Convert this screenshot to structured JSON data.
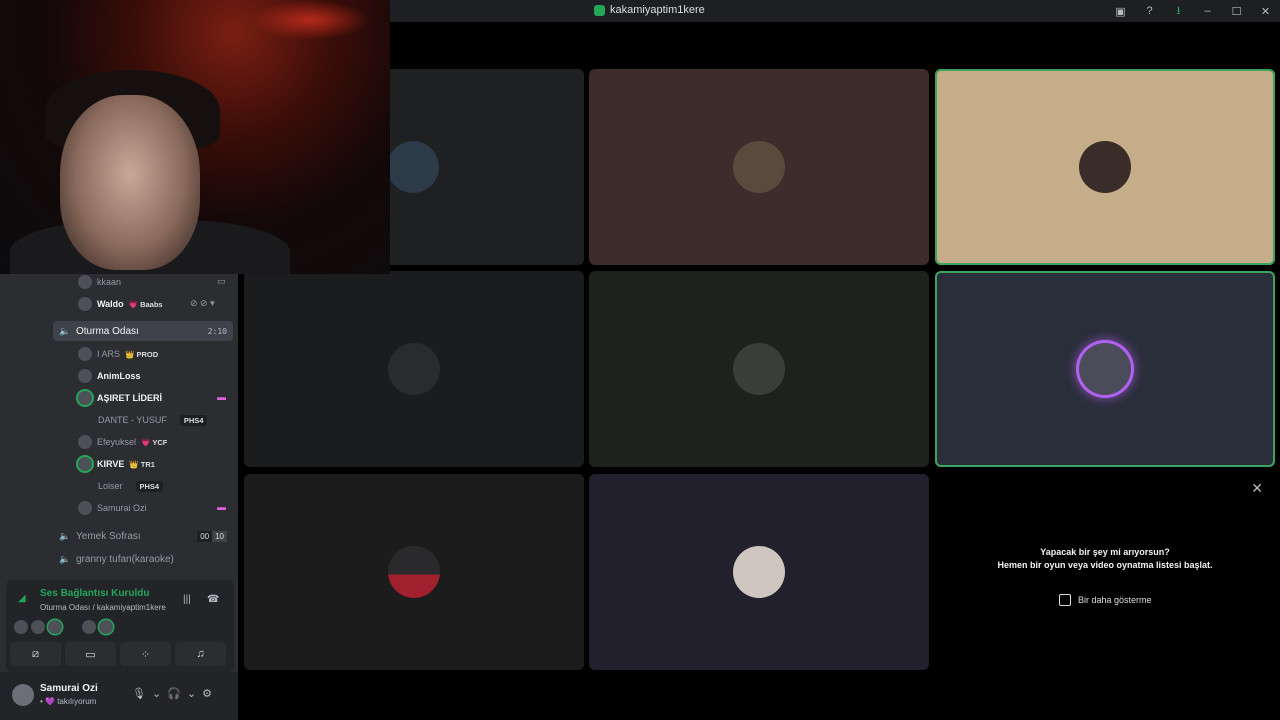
{
  "titlebar": {
    "title": "kakamiyaptim1kere",
    "icons": [
      "inbox-icon",
      "help-icon",
      "download-icon",
      "minimize-icon",
      "maximize-icon",
      "close-icon"
    ]
  },
  "sidebar": {
    "upper_members": [
      {
        "name": "kkaan",
        "tag": ""
      },
      {
        "name": "Waldo",
        "tag": "💗 Baabs"
      }
    ],
    "channels": [
      {
        "name": "Oturma Odası",
        "timer": "2:10",
        "active": true,
        "members": [
          {
            "name": "I ARS",
            "tag": "👑 PROD"
          },
          {
            "name": "AnimLoss",
            "tag": ""
          },
          {
            "name": "AŞIRET LİDERİ",
            "tag": ""
          },
          {
            "name": "DANTE - YUSUF",
            "tag": "PHS4"
          },
          {
            "name": "Efeyuksel",
            "tag": "💗 YCF"
          },
          {
            "name": "KIRVE",
            "tag": "👑 TR1"
          },
          {
            "name": "Loiser",
            "tag": "PHS4"
          },
          {
            "name": "Samurai Ozi",
            "tag": ""
          }
        ]
      },
      {
        "name": "Yemek Sofrası",
        "count_a": "00",
        "count_b": "10"
      },
      {
        "name": "granny tufan(karaoke)"
      }
    ]
  },
  "voice_panel": {
    "status": "Ses Bağlantısı Kuruldu",
    "location": "Oturma Odası / kakamiyaptim1kere",
    "buttons": [
      "camera-off-icon",
      "screen-share-icon",
      "activities-icon",
      "soundboard-icon"
    ]
  },
  "user": {
    "name": "Samurai Ozi",
    "status": "• 💜 takılıyorum"
  },
  "activity_prompt": {
    "line1": "Yapacak bir şey mi arıyorsun?",
    "line2": "Hemen bir oyun veya video oynatma listesi başlat.",
    "checkbox": "Bir daha gösterme"
  },
  "colors": {
    "speaking": "#3ba55d",
    "sidebar": "#2b2d31",
    "accent_green": "#23a55a"
  }
}
